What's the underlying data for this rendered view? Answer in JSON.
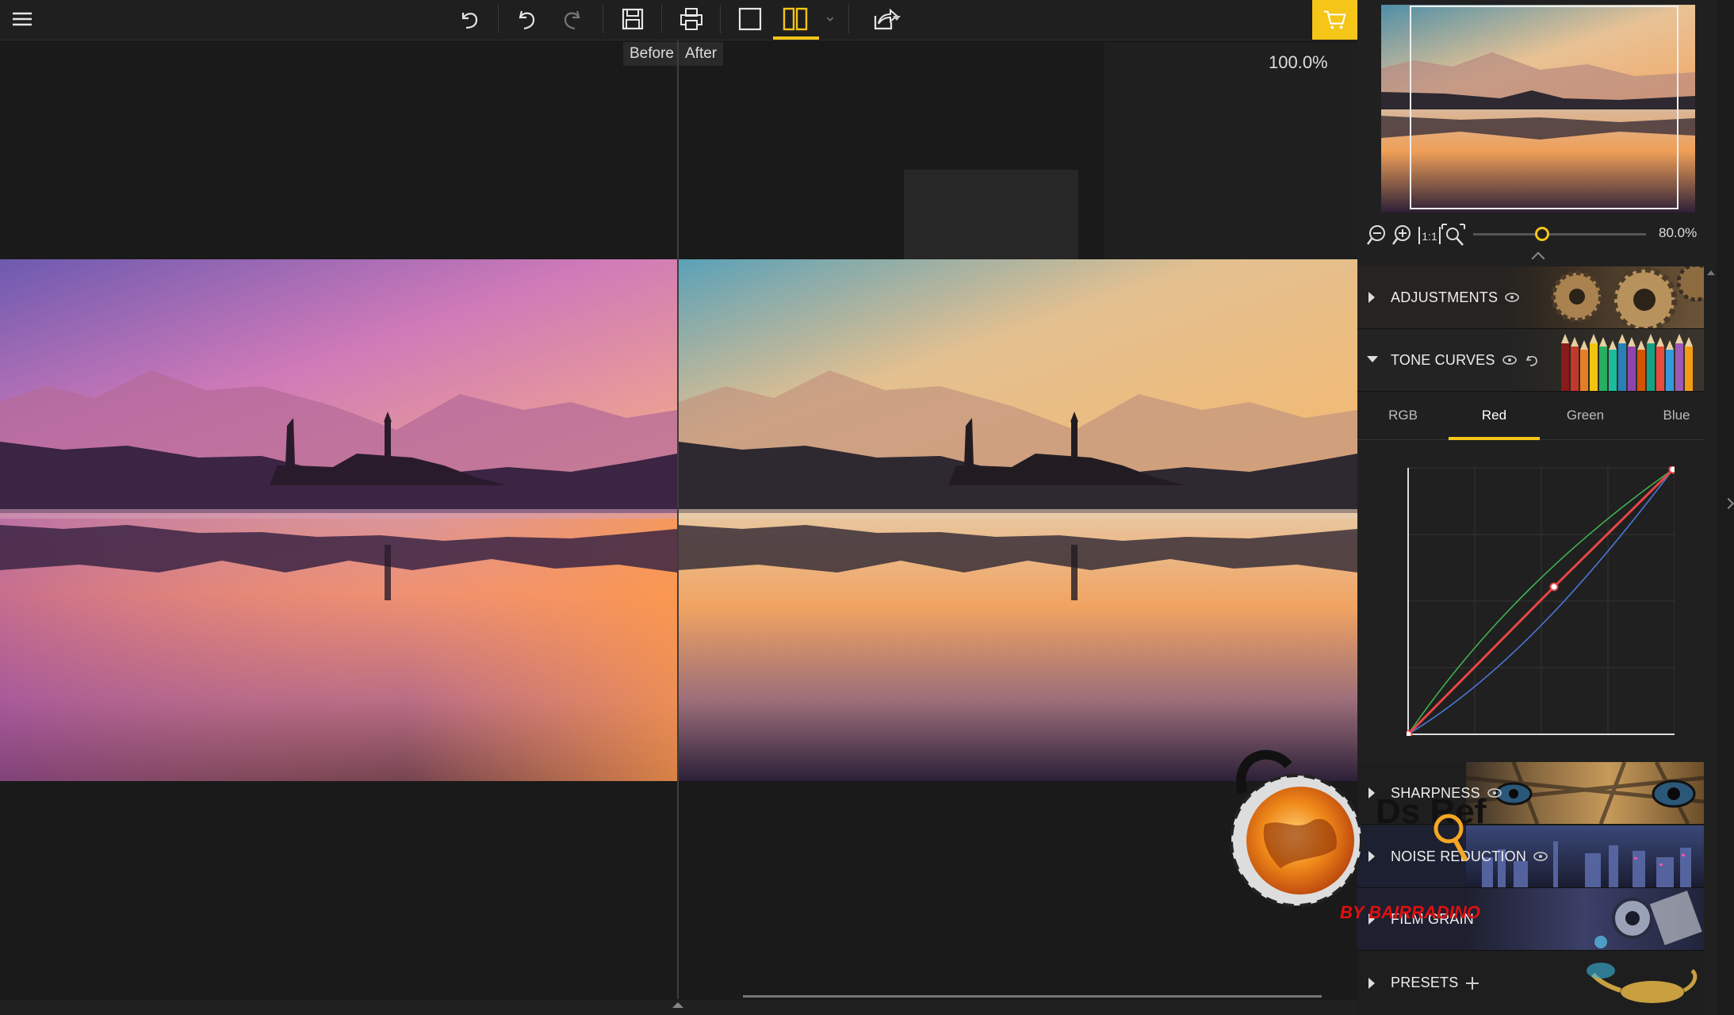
{
  "toolbar": {
    "icons": [
      "menu-icon",
      "undo-all-icon",
      "undo-icon",
      "redo-icon",
      "save-icon",
      "print-icon",
      "single-view-icon",
      "split-view-icon",
      "view-dropdown-icon",
      "share-icon",
      "cart-icon"
    ],
    "accent": "#f5c518"
  },
  "canvas": {
    "before_label": "Before",
    "after_label": "After",
    "zoom": "100.0%"
  },
  "navigator": {
    "zoom": "80.0%",
    "zoom_level": 0.4
  },
  "sections": {
    "adjustments": "ADJUSTMENTS",
    "tone_curves": "TONE CURVES",
    "sharpness": "SHARPNESS",
    "noise_reduction": "NOISE REDUCTION",
    "film_grain": "FILM GRAIN",
    "presets": "PRESETS"
  },
  "tone_tabs": {
    "rgb": "RGB",
    "red": "Red",
    "green": "Green",
    "blue": "Blue",
    "active": "Red"
  },
  "curve_colors": {
    "red": "#e84545",
    "green": "#3fb34f",
    "blue": "#4a78d8"
  },
  "watermark": {
    "logo_text": "Ds Ref",
    "by_text": "BY BAIRRADINO"
  }
}
